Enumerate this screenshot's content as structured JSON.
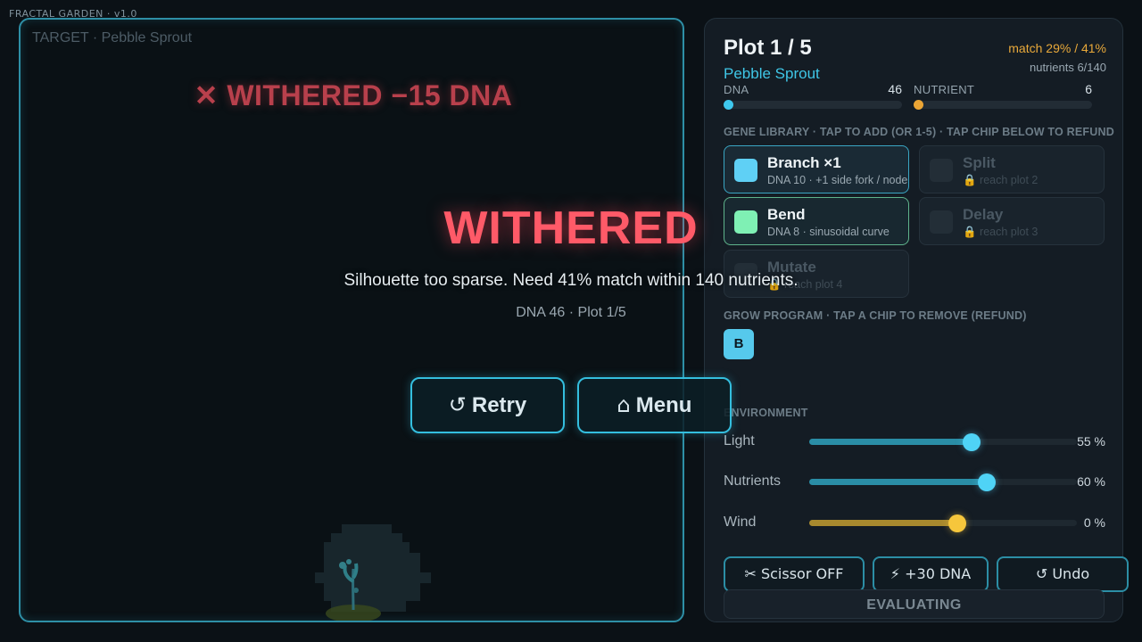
{
  "app": {
    "version_label": "FRACTAL GARDEN · v1.0"
  },
  "garden": {
    "target_label": "TARGET · Pebble Sprout",
    "banner": "✕ WITHERED  −15 DNA"
  },
  "panel": {
    "plot_title": "Plot 1 / 5",
    "plot_name": "Pebble Sprout",
    "match": "match 29% / 41%",
    "nutrients": "nutrients 6/140",
    "dna": {
      "label": "DNA",
      "value": "46"
    },
    "nutrient": {
      "label": "NUTRIENT",
      "value": "6"
    },
    "gene_library_heading": "GENE LIBRARY · TAP TO ADD (OR 1-5) · TAP CHIP BELOW TO REFUND",
    "genes": [
      {
        "name": "Branch ×1",
        "desc": "DNA 10 · +1 side fork / node",
        "color": "#5fd0f5",
        "locked": false
      },
      {
        "name": "Split",
        "desc": "🔒 reach plot 2",
        "color": "#232e37",
        "locked": true
      },
      {
        "name": "Bend",
        "desc": "DNA 8 · sinusoidal curve",
        "color": "#7ff0b4",
        "locked": false
      },
      {
        "name": "Delay",
        "desc": "🔒 reach plot 3",
        "color": "#232e37",
        "locked": true
      },
      {
        "name": "Mutate",
        "desc": "🔒 reach plot 4",
        "color": "#232e37",
        "locked": true
      }
    ],
    "grow_program_heading": "GROW PROGRAM · TAP A CHIP TO REMOVE (REFUND)",
    "program_chips": [
      "B"
    ],
    "environment_heading": "ENVIRONMENT",
    "environment": [
      {
        "label": "Light",
        "value": 0.55,
        "display": "55 %",
        "color": "#3ac2e4"
      },
      {
        "label": "Nutrients",
        "value": 0.6,
        "display": "60 %",
        "color": "#3ac2e4"
      },
      {
        "label": "Wind",
        "value": 0.0,
        "display": "0 %",
        "color": "#f2c23a"
      }
    ],
    "tools": {
      "scissor": "✂ Scissor OFF",
      "boost": "⚡ +30 DNA",
      "undo": "↺ Undo"
    },
    "evaluating": "EVALUATING"
  },
  "modal": {
    "title": "WITHERED",
    "message": "Silhouette too sparse. Need 41% match within 140 nutrients.",
    "sub": "DNA 46 · Plot 1/5",
    "retry_icon": "↺",
    "retry": "Retry",
    "menu_icon": "⌂",
    "menu": "Menu"
  }
}
